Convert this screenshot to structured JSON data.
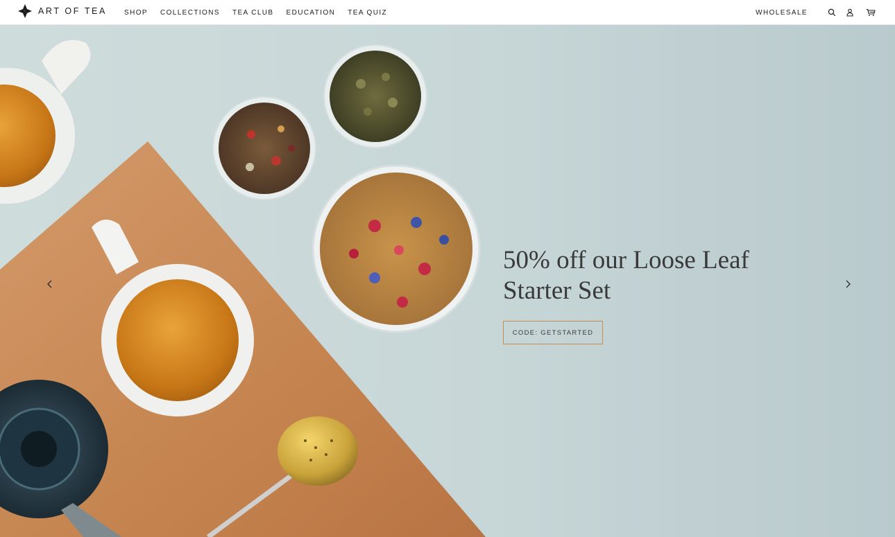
{
  "header": {
    "brand": "ART OF TEA",
    "nav": [
      {
        "label": "SHOP"
      },
      {
        "label": "COLLECTIONS"
      },
      {
        "label": "TEA CLUB"
      },
      {
        "label": "EDUCATION"
      },
      {
        "label": "TEA QUIZ"
      }
    ],
    "wholesale": "WHOLESALE",
    "icons": [
      "search-icon",
      "account-icon",
      "cart-icon"
    ]
  },
  "hero": {
    "headline_line1": "50% off our Loose Leaf",
    "headline_line2": "Starter Set",
    "cta_label": "CODE: GETSTARTED",
    "prev_icon": "chevron-left-icon",
    "next_icon": "chevron-right-icon"
  },
  "colors": {
    "accent": "#c98a4e",
    "text": "#1c1c1c",
    "hero_bg": "#c7d6d7"
  }
}
